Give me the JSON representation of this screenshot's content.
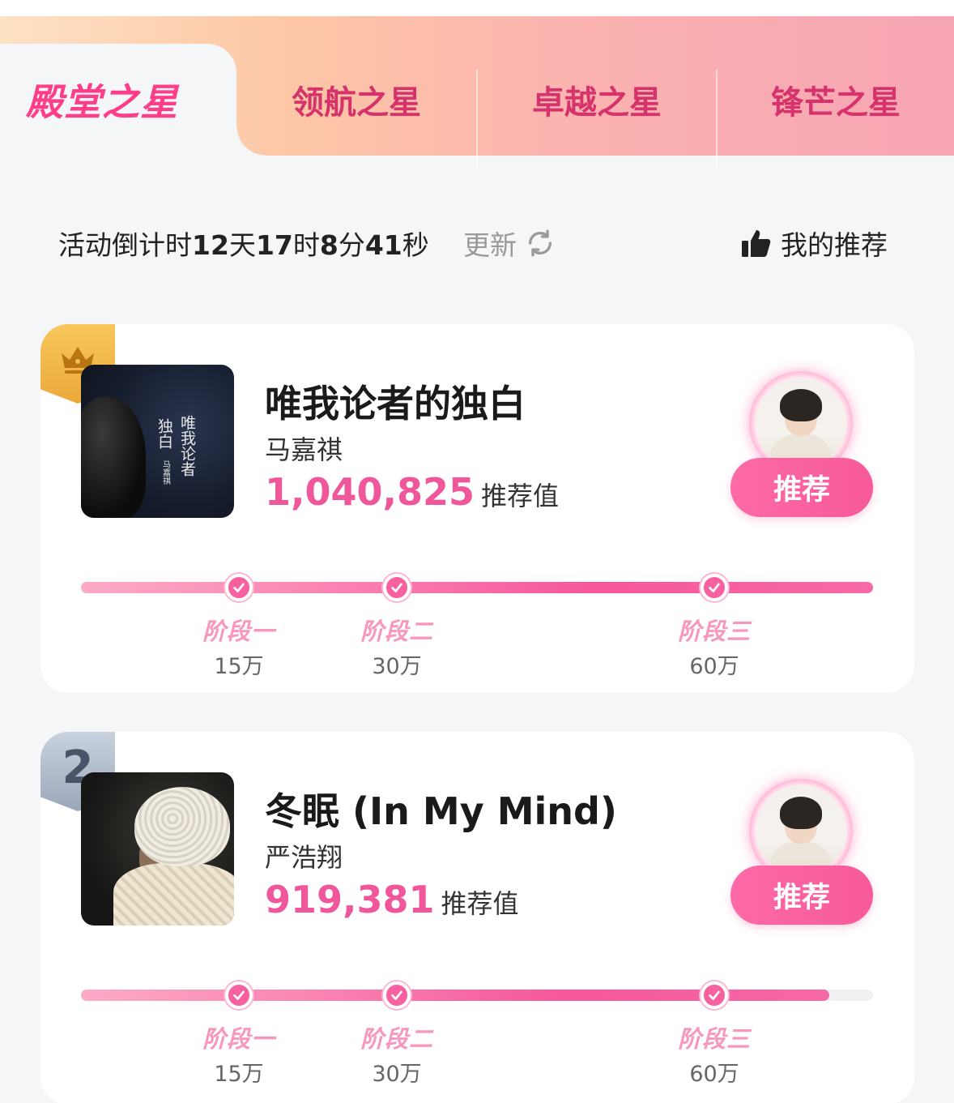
{
  "tabs": [
    {
      "label": "殿堂之星",
      "active": true
    },
    {
      "label": "领航之星",
      "active": false
    },
    {
      "label": "卓越之星",
      "active": false
    },
    {
      "label": "锋芒之星",
      "active": false
    }
  ],
  "countdown": {
    "prefix": "活动倒计时",
    "days": "12",
    "days_unit": "天",
    "hours": "17",
    "hours_unit": "时",
    "minutes": "8",
    "minutes_unit": "分",
    "seconds": "41",
    "seconds_unit": "秒"
  },
  "refresh": {
    "label": "更新",
    "icon": "refresh-icon"
  },
  "my_recommend": {
    "label": "我的推荐",
    "icon": "thumbs-up-icon"
  },
  "colors": {
    "accent": "#f0579a",
    "button": "#f85a99",
    "gold": "#f2b64a",
    "silver": "#aab5c5"
  },
  "entries": [
    {
      "rank": "1",
      "rank_icon": "crown-icon",
      "title": "唯我论者的独白",
      "artist": "马嘉祺",
      "score": "1,040,825",
      "score_unit": "推荐值",
      "cover_text": [
        "唯我论者",
        "独白"
      ],
      "cover_small": "马嘉祺",
      "button": "推荐",
      "progress": 1.0,
      "milestones": [
        {
          "label": "阶段一",
          "amount": "15万"
        },
        {
          "label": "阶段二",
          "amount": "30万"
        },
        {
          "label": "阶段三",
          "amount": "60万"
        }
      ]
    },
    {
      "rank": "2",
      "title": "冬眠 (In My Mind)",
      "artist": "严浩翔",
      "score": "919,381",
      "score_unit": "推荐值",
      "button": "推荐",
      "progress": 0.945,
      "milestones": [
        {
          "label": "阶段一",
          "amount": "15万"
        },
        {
          "label": "阶段二",
          "amount": "30万"
        },
        {
          "label": "阶段三",
          "amount": "60万"
        }
      ]
    }
  ]
}
